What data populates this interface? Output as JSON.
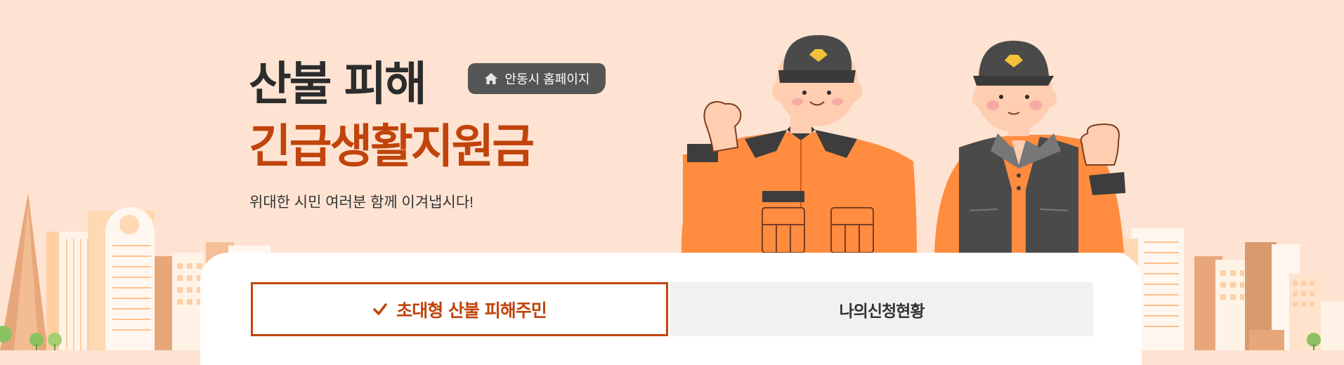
{
  "hero": {
    "title_line1": "산불 피해",
    "title_line2": "긴급생활지원금",
    "tagline": "위대한 시민 여러분 함께 이겨냅시다!",
    "home_button_label": "안동시 홈페이지"
  },
  "tabs": [
    {
      "label": "초대형 산불 피해주민",
      "active": true
    },
    {
      "label": "나의신청현황",
      "active": false
    }
  ],
  "colors": {
    "background": "#fee3d2",
    "accent": "#c0440c",
    "dark_text": "#2c2c2c",
    "button_dark": "#555555",
    "tab_inactive_bg": "#f1f1f1",
    "uniform_orange": "#ff8c3f",
    "uniform_dark": "#444444"
  },
  "icons": {
    "home_button": "home-icon",
    "active_tab": "check-icon"
  }
}
